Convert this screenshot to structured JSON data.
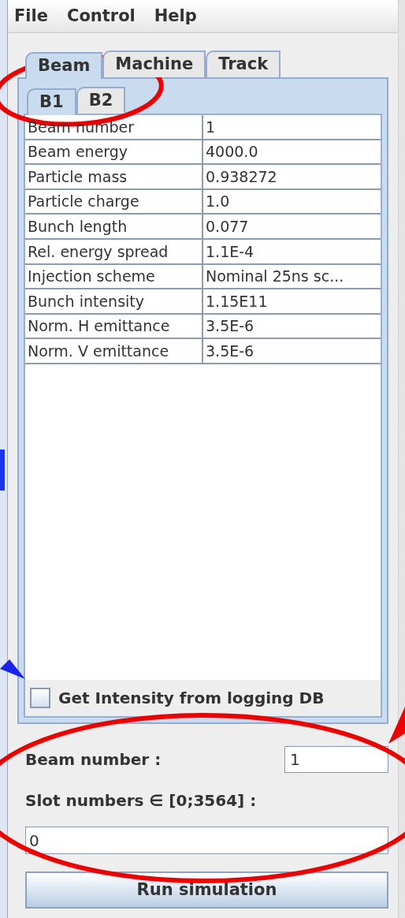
{
  "menu": [
    "File",
    "Control",
    "Help"
  ],
  "tabs": [
    {
      "label": "Beam",
      "selected": true
    },
    {
      "label": "Machine",
      "selected": false
    },
    {
      "label": "Track",
      "selected": false
    }
  ],
  "subtabs": [
    {
      "label": "B1",
      "selected": true
    },
    {
      "label": "B2",
      "selected": false
    }
  ],
  "table": {
    "rows": [
      [
        "Beam number",
        "1"
      ],
      [
        "Beam energy",
        "4000.0"
      ],
      [
        "Particle mass",
        "0.938272"
      ],
      [
        "Particle charge",
        "1.0"
      ],
      [
        "Bunch length",
        "0.077"
      ],
      [
        "Rel. energy spread",
        "1.1E-4"
      ],
      [
        "Injection scheme",
        "Nominal 25ns sc..."
      ],
      [
        "Bunch intensity",
        "1.15E11"
      ],
      [
        "Norm. H emittance",
        "3.5E-6"
      ],
      [
        "Norm. V emittance",
        "3.5E-6"
      ]
    ]
  },
  "intensity_checkbox": {
    "label": "Get Intensity from logging DB",
    "checked": false
  },
  "beam_number": {
    "label": "Beam number :",
    "value": "1"
  },
  "slot_numbers": {
    "label": "Slot numbers ∈ [0;3564] :",
    "value": "0"
  },
  "run_button": "Run simulation"
}
